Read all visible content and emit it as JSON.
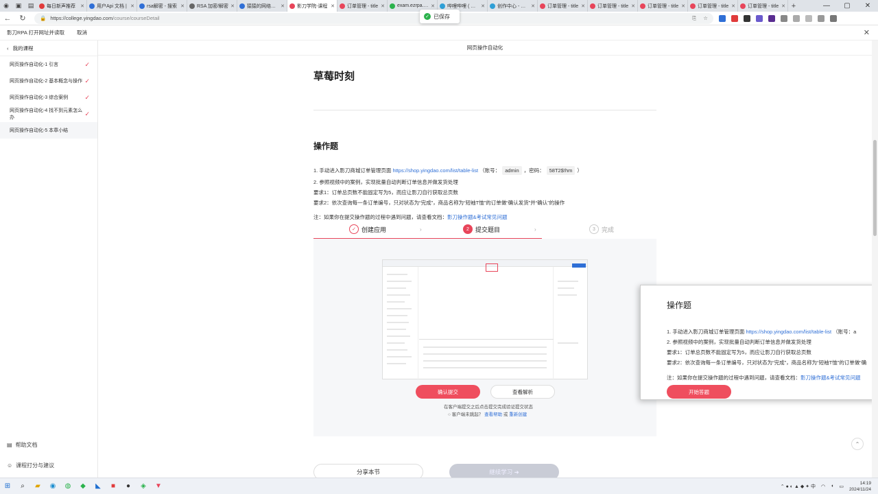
{
  "browser": {
    "tabs": [
      {
        "title": "每日新声推荐",
        "color": "#e03b3b"
      },
      {
        "title": "用户Api 文档 |",
        "color": "#2f6fd6"
      },
      {
        "title": "rsa解密 - 搜索",
        "color": "#2f6fd6"
      },
      {
        "title": "RSA 加密/解密",
        "color": "#666666"
      },
      {
        "title": "猿猿的网络验证",
        "color": "#2f6fd6"
      },
      {
        "title": "影刀学院-课程",
        "color": "#e8455a",
        "active": true
      },
      {
        "title": "订单管理 - title",
        "color": "#e8455a"
      },
      {
        "title": "exam.ezrpa.stor",
        "color": "#2bb24c"
      },
      {
        "title": "哔哩哔哩 ( ゜- ゜",
        "color": "#2f9fd6"
      },
      {
        "title": "创作中心 - 哔哩",
        "color": "#2f9fd6"
      },
      {
        "title": "订单管理 - title",
        "color": "#e8455a"
      },
      {
        "title": "订单管理 - title",
        "color": "#e8455a"
      },
      {
        "title": "订单管理 - title",
        "color": "#e8455a"
      },
      {
        "title": "订单管理 - title",
        "color": "#e8455a"
      },
      {
        "title": "订单管理 - title",
        "color": "#e8455a"
      }
    ],
    "url_main": "https://college.yingdao.com",
    "url_dim": "/course/courseDetail",
    "toast": "已保存"
  },
  "app_header": {
    "left_text": "影刀RPA 打开网址并读取",
    "cancel": "取消"
  },
  "sidebar": {
    "back_label": "我的课程",
    "lessons": [
      {
        "label": "网页操作自动化-1 引言",
        "done": true
      },
      {
        "label": "网页操作自动化-2 基本概念与操作",
        "done": true
      },
      {
        "label": "网页操作自动化-3 综合案例",
        "done": true
      },
      {
        "label": "网页操作自动化-4 找不到元素怎么办",
        "done": true
      },
      {
        "label": "网页操作自动化-5 本章小结",
        "done": false
      }
    ],
    "help_doc": "帮助文档",
    "rate": "课程打分与建议"
  },
  "page_title": "网页操作自动化",
  "content": {
    "heading": "草莓时刻",
    "section": "操作题",
    "line1_pre": "1. 手动进入影刀商城订单管理页面",
    "line1_link": "https://shop.yingdao.com/list/table-list",
    "line1_acc_label": "（账号：",
    "line1_acc": "admin",
    "line1_pwd_label": "，密码：",
    "line1_pwd": "58T2$!hm",
    "line1_end": "）",
    "line2": "2. 参照视频中的案例，实现批量自动判断订单信息并做发货处理",
    "req1": "要求1：订单总页数不能固定写为5，而应让影刀自行获取总页数",
    "req2": "要求2：依次查询每一条订单编号，只对状态为“完成”，商品名称为“短袖T恤”的订单做“确认发货”并“确认”的操作",
    "note_pre": "注：如果你在提交操作题的过程中遇到问题，请查看文档：",
    "note_link": "影刀操作题&考试常见问题"
  },
  "steps": [
    {
      "num": "✓",
      "label": "创建应用"
    },
    {
      "num": "2",
      "label": "提交题目"
    },
    {
      "num": "3",
      "label": "完成"
    }
  ],
  "preview": {
    "confirm_btn": "确认提交",
    "analysis_btn": "查看解析",
    "hint": "在客户端提交之后点击提交完成验证提交状态",
    "hint2_pre": "客户端未跳起？",
    "hint2_link1": "查看帮助",
    "hint2_or": "或",
    "hint2_link2": "重新创建"
  },
  "bottom": {
    "share": "分享本节",
    "next": "继续学习 ➜"
  },
  "panel": {
    "title": "操作题",
    "line1_pre": "1. 手动进入影刀商城订单管理页面",
    "line1_link": "https://shop.yingdao.com/list/table-list",
    "line1_acc": "（账号：a",
    "line2": "2. 参照视频中的案例，实现批量自动判断订单信息并做发货处理",
    "req1": "要求1：订单总页数不能固定写为5，而应让影刀自行获取总页数",
    "req2": "要求2：依次查询每一条订单编号，只对状态为“完成”，商品名称为“短袖T恤”的订单做“确",
    "note_pre": "注：如果你在提交操作题的过程中遇到问题，请查看文档：",
    "note_link": "影刀操作题&考试常见问题",
    "start_btn": "开始答题"
  },
  "taskbar": {
    "time": "14:19",
    "date": "2024/11/24"
  },
  "colors": {
    "accent": "#e8455a",
    "link": "#2f6fd6",
    "check": "#2bb24c"
  }
}
